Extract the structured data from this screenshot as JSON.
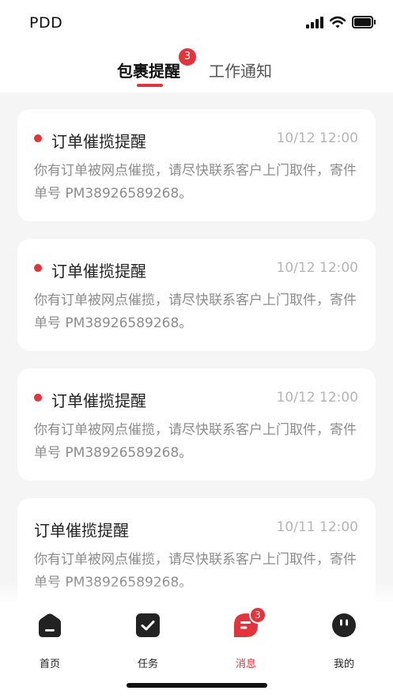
{
  "status_bar": {
    "carrier": "PDD"
  },
  "tabs": [
    {
      "label": "包裹提醒",
      "badge": "3",
      "active": true
    },
    {
      "label": "工作通知",
      "active": false
    }
  ],
  "notifications": [
    {
      "title": "订单催揽提醒",
      "time": "10/12 12:00",
      "content": "你有订单被网点催揽，请尽快联系客户上门取件，寄件单号 PM38926589268。",
      "unread": true
    },
    {
      "title": "订单催揽提醒",
      "time": "10/12 12:00",
      "content": "你有订单被网点催揽，请尽快联系客户上门取件，寄件单号 PM38926589268。",
      "unread": true
    },
    {
      "title": "订单催揽提醒",
      "time": "10/12 12:00",
      "content": "你有订单被网点催揽，请尽快联系客户上门取件，寄件单号 PM38926589268。",
      "unread": true
    },
    {
      "title": "订单催揽提醒",
      "time": "10/11 12:00",
      "content": "你有订单被网点催揽，请尽快联系客户上门取件，寄件单号 PM38926589268。",
      "unread": false
    }
  ],
  "bottom_nav": [
    {
      "label": "首页",
      "icon": "home-icon"
    },
    {
      "label": "任务",
      "icon": "task-icon"
    },
    {
      "label": "消息",
      "icon": "message-icon",
      "badge": "3",
      "active": true
    },
    {
      "label": "我的",
      "icon": "profile-icon"
    }
  ],
  "colors": {
    "accent": "#e3333c",
    "background": "#f5f5f5",
    "card": "#ffffff"
  }
}
